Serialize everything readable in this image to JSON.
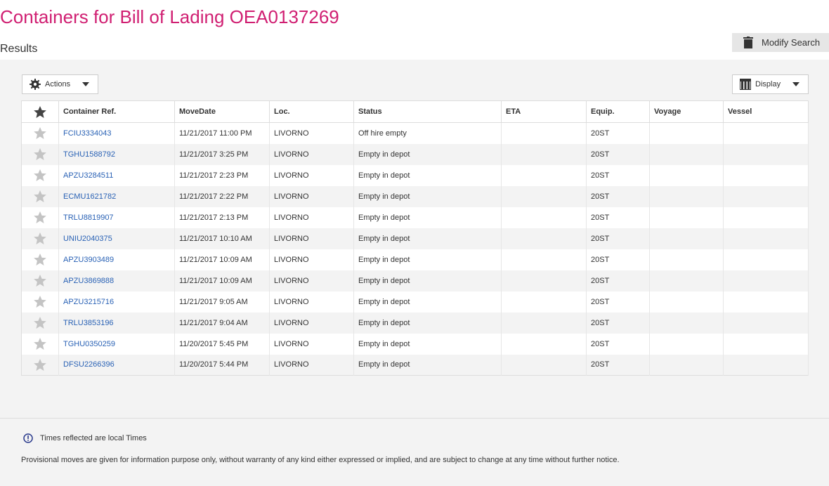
{
  "page": {
    "title": "Containers for Bill of Lading OEA0137269",
    "results_label": "Results",
    "modify_search_label": "Modify Search"
  },
  "toolbar": {
    "actions_label": "Actions",
    "display_label": "Display"
  },
  "table": {
    "columns": [
      "Container Ref.",
      "MoveDate",
      "Loc.",
      "Status",
      "ETA",
      "Equip.",
      "Voyage",
      "Vessel"
    ],
    "rows": [
      {
        "ref": "FCIU3334043",
        "date": "11/21/2017 11:00 PM",
        "loc": "LIVORNO",
        "status": "Off hire empty",
        "eta": "",
        "equip": "20ST",
        "voyage": "",
        "vessel": ""
      },
      {
        "ref": "TGHU1588792",
        "date": "11/21/2017 3:25 PM",
        "loc": "LIVORNO",
        "status": "Empty in depot",
        "eta": "",
        "equip": "20ST",
        "voyage": "",
        "vessel": ""
      },
      {
        "ref": "APZU3284511",
        "date": "11/21/2017 2:23 PM",
        "loc": "LIVORNO",
        "status": "Empty in depot",
        "eta": "",
        "equip": "20ST",
        "voyage": "",
        "vessel": ""
      },
      {
        "ref": "ECMU1621782",
        "date": "11/21/2017 2:22 PM",
        "loc": "LIVORNO",
        "status": "Empty in depot",
        "eta": "",
        "equip": "20ST",
        "voyage": "",
        "vessel": ""
      },
      {
        "ref": "TRLU8819907",
        "date": "11/21/2017 2:13 PM",
        "loc": "LIVORNO",
        "status": "Empty in depot",
        "eta": "",
        "equip": "20ST",
        "voyage": "",
        "vessel": ""
      },
      {
        "ref": "UNIU2040375",
        "date": "11/21/2017 10:10 AM",
        "loc": "LIVORNO",
        "status": "Empty in depot",
        "eta": "",
        "equip": "20ST",
        "voyage": "",
        "vessel": ""
      },
      {
        "ref": "APZU3903489",
        "date": "11/21/2017 10:09 AM",
        "loc": "LIVORNO",
        "status": "Empty in depot",
        "eta": "",
        "equip": "20ST",
        "voyage": "",
        "vessel": ""
      },
      {
        "ref": "APZU3869888",
        "date": "11/21/2017 10:09 AM",
        "loc": "LIVORNO",
        "status": "Empty in depot",
        "eta": "",
        "equip": "20ST",
        "voyage": "",
        "vessel": ""
      },
      {
        "ref": "APZU3215716",
        "date": "11/21/2017 9:05 AM",
        "loc": "LIVORNO",
        "status": "Empty in depot",
        "eta": "",
        "equip": "20ST",
        "voyage": "",
        "vessel": ""
      },
      {
        "ref": "TRLU3853196",
        "date": "11/21/2017 9:04 AM",
        "loc": "LIVORNO",
        "status": "Empty in depot",
        "eta": "",
        "equip": "20ST",
        "voyage": "",
        "vessel": ""
      },
      {
        "ref": "TGHU0350259",
        "date": "11/20/2017 5:45 PM",
        "loc": "LIVORNO",
        "status": "Empty in depot",
        "eta": "",
        "equip": "20ST",
        "voyage": "",
        "vessel": ""
      },
      {
        "ref": "DFSU2266396",
        "date": "11/20/2017 5:44 PM",
        "loc": "LIVORNO",
        "status": "Empty in depot",
        "eta": "",
        "equip": "20ST",
        "voyage": "",
        "vessel": ""
      }
    ]
  },
  "footer": {
    "local_times_note": "Times reflected are local Times",
    "disclaimer": "Provisional moves are given for information purpose only, without warranty of any kind either expressed or implied, and are subject to change at any time without further notice."
  },
  "icons": {
    "modify": "trash-icon",
    "actions": "gear-icon",
    "display": "columns-icon",
    "favorite": "star-icon",
    "info": "info-icon"
  },
  "colors": {
    "title": "#d01f72",
    "link": "#2a62b5",
    "star_header": "#444444",
    "star_row": "#c4c4c4"
  }
}
